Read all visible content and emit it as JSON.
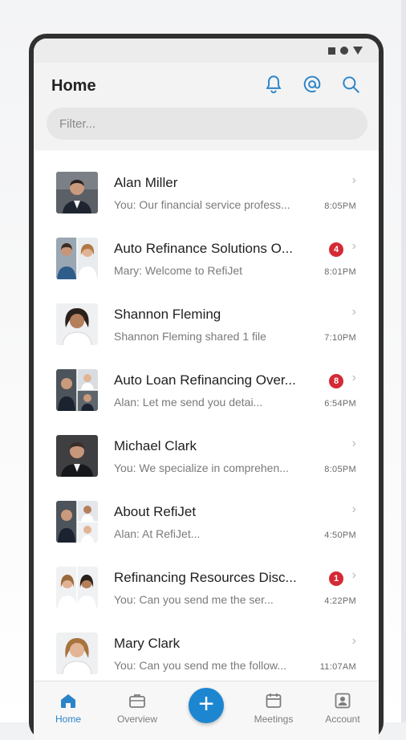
{
  "header": {
    "title": "Home",
    "filter_placeholder": "Filter...",
    "accent": "#2b84c8"
  },
  "conversations": [
    {
      "title": "Alan Miller",
      "preview": "You: Our financial service profess...",
      "time": "8:05PM",
      "badge": ""
    },
    {
      "title": "Auto Refinance Solutions O...",
      "preview": "Mary:  Welcome to RefiJet",
      "time": "8:01PM",
      "badge": "4"
    },
    {
      "title": "Shannon Fleming",
      "preview": "Shannon Fleming shared 1 file",
      "time": "7:10PM",
      "badge": ""
    },
    {
      "title": "Auto Loan Refinancing Over...",
      "preview": "Alan:  Let me send you detai...",
      "time": "6:54PM",
      "badge": "8"
    },
    {
      "title": "Michael Clark",
      "preview": "You: We specialize in comprehen...",
      "time": "8:05PM",
      "badge": ""
    },
    {
      "title": "About RefiJet",
      "preview": "Alan:  At RefiJet...",
      "time": "4:50PM",
      "badge": ""
    },
    {
      "title": "Refinancing Resources Disc...",
      "preview": "You:  Can you send me the ser...",
      "time": "4:22PM",
      "badge": "1"
    },
    {
      "title": "Mary Clark",
      "preview": "You: Can you send me the follow...",
      "time": "11:07AM",
      "badge": ""
    }
  ],
  "nav": {
    "home": "Home",
    "overview": "Overview",
    "add": "+",
    "meetings": "Meetings",
    "account": "Account"
  },
  "chevron": "›"
}
